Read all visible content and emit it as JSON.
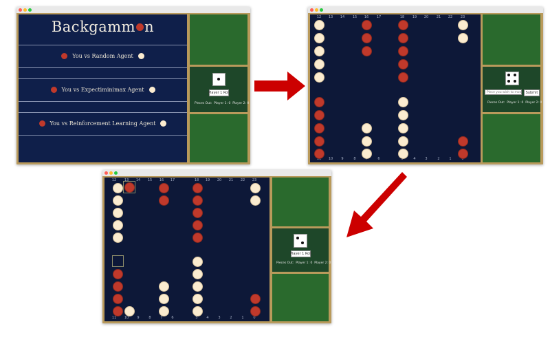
{
  "menu": {
    "title_prefix": "Backgamm",
    "title_suffix": "n",
    "options": [
      "You vs Random Agent",
      "You vs Expectiminimax Agent",
      "You vs Reinforcement Learning Agent"
    ]
  },
  "points": {
    "top": [
      "12",
      "13",
      "14",
      "15",
      "16",
      "17",
      "18",
      "19",
      "20",
      "21",
      "22",
      "23"
    ],
    "bottom": [
      "11",
      "10",
      "9",
      "8",
      "7",
      "6",
      "5",
      "4",
      "3",
      "2",
      "1",
      "0"
    ]
  },
  "controls": {
    "roll_button": "Player 1 Roll",
    "move_placeholder": "Piece you wish to move...",
    "submit_button": "Submit",
    "status_pieces_out": "Pieces Out:",
    "status_p1": "Player 1: 0",
    "status_p2": "Player 2: 0"
  },
  "dice": {
    "window1": 1,
    "window2": 4,
    "window3": 2
  },
  "colors": {
    "board": "#0d1838",
    "frame": "#b99a5b",
    "panel_green": "#2a6a2d",
    "panel_dark": "#1e4729",
    "red_checker": "#c0392b",
    "white_checker": "#fbecd0",
    "arrow": "#cc0000"
  }
}
